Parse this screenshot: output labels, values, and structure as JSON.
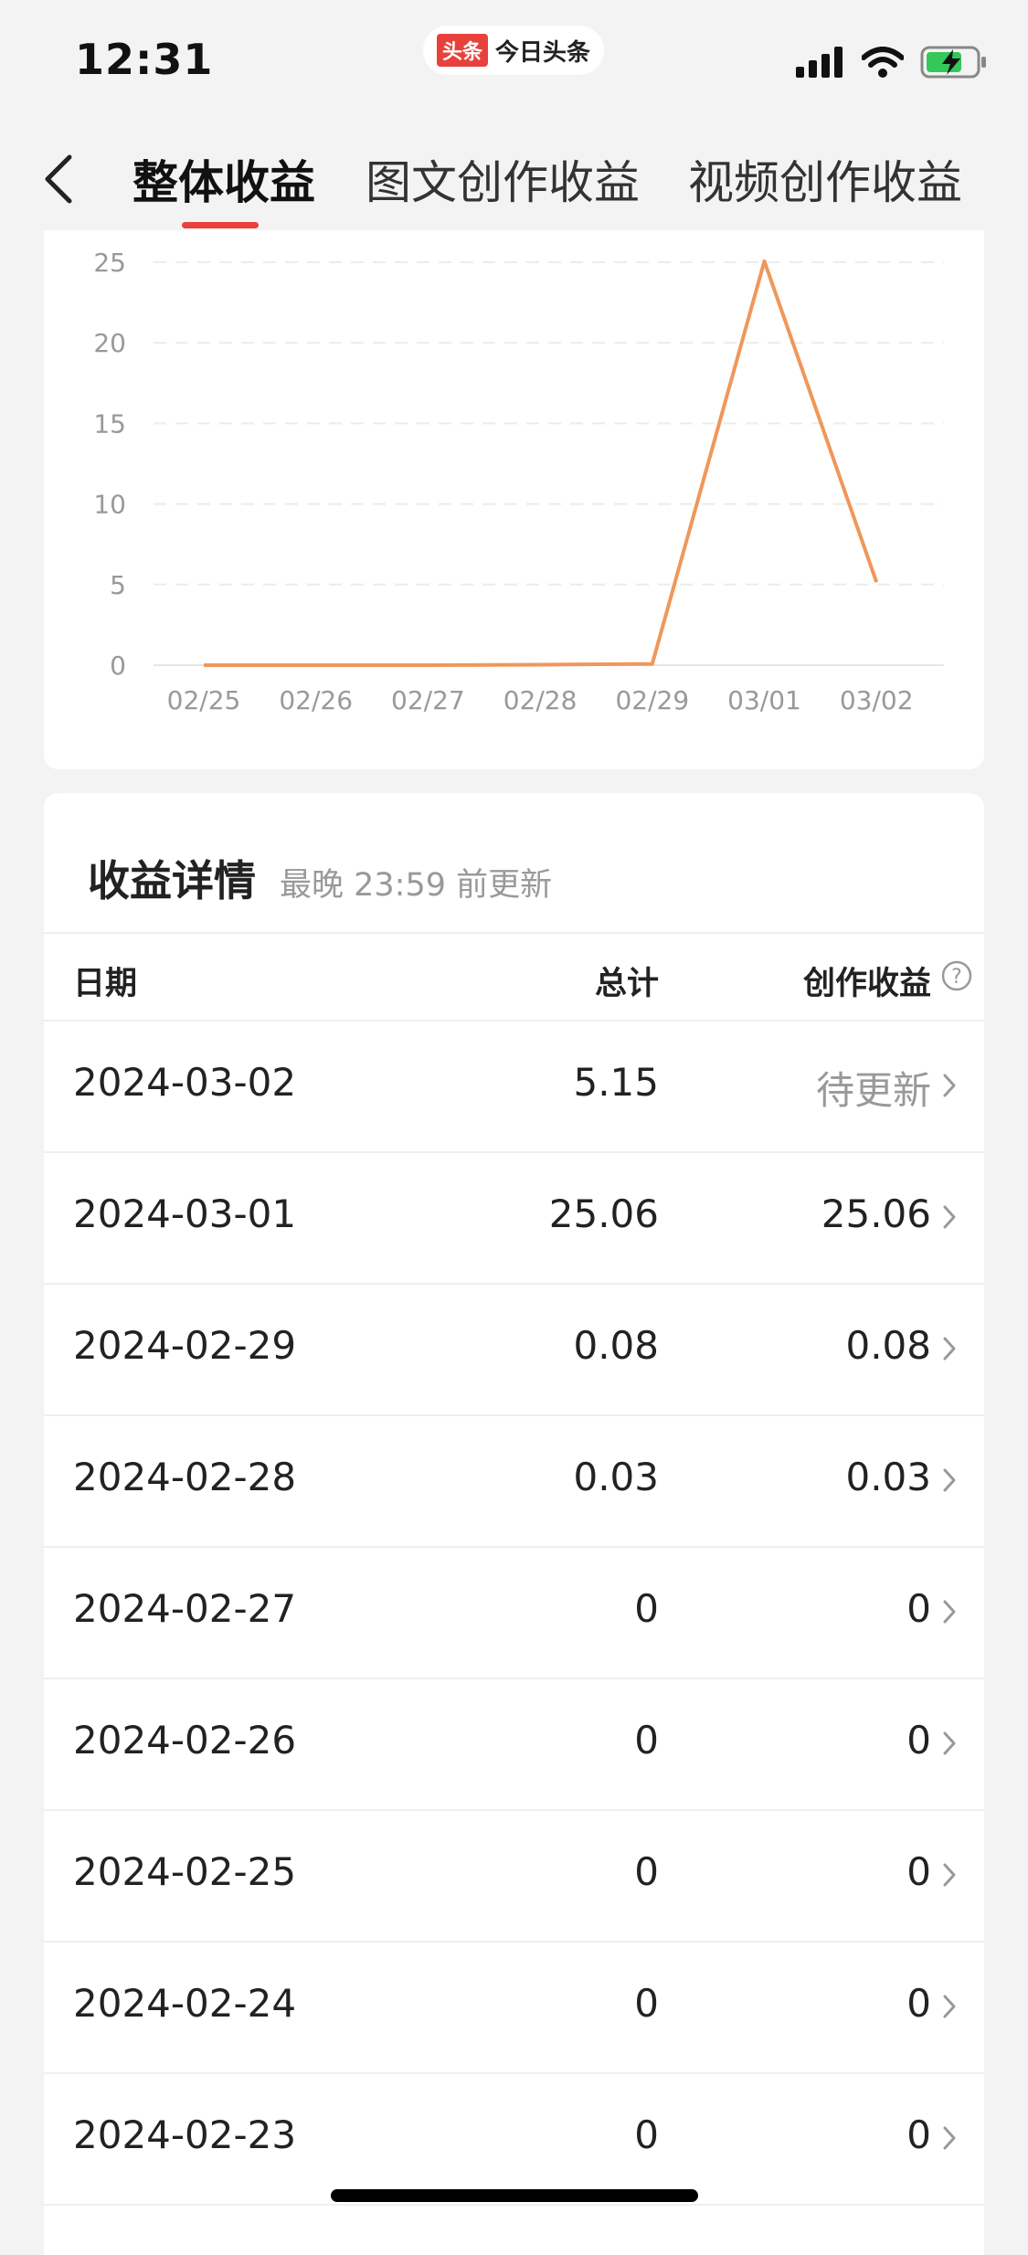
{
  "status_bar": {
    "time": "12:31",
    "app_logo": "头条",
    "app_name": "今日头条",
    "icons": [
      "signal-icon",
      "wifi-icon",
      "battery-charging-icon"
    ]
  },
  "header": {
    "back_icon": "back-chevron-icon",
    "tabs": [
      {
        "label": "整体收益",
        "active": true
      },
      {
        "label": "图文创作收益",
        "active": false
      },
      {
        "label": "视频创作收益",
        "active": false
      }
    ],
    "accent_color": "#e8413c"
  },
  "chart_data": {
    "type": "line",
    "categories": [
      "02/25",
      "02/26",
      "02/27",
      "02/28",
      "02/29",
      "03/01",
      "03/02"
    ],
    "series": [
      {
        "values": [
          0,
          0,
          0,
          0.03,
          0.08,
          25.06,
          5.15
        ],
        "color": "#f0975a"
      }
    ],
    "y_ticks": [
      0,
      5,
      10,
      15,
      20,
      25
    ],
    "ylim": [
      0,
      25
    ],
    "grid": true
  },
  "detail": {
    "title": "收益详情",
    "subtitle": "最晚 23:59 前更新",
    "columns": {
      "date": "日期",
      "total": "总计",
      "creation": "创作收益"
    },
    "help_icon": "question-circle-icon",
    "rows": [
      {
        "date": "2024-03-02",
        "total": "5.15",
        "creation": "待更新"
      },
      {
        "date": "2024-03-01",
        "total": "25.06",
        "creation": "25.06"
      },
      {
        "date": "2024-02-29",
        "total": "0.08",
        "creation": "0.08"
      },
      {
        "date": "2024-02-28",
        "total": "0.03",
        "creation": "0.03"
      },
      {
        "date": "2024-02-27",
        "total": "0",
        "creation": "0"
      },
      {
        "date": "2024-02-26",
        "total": "0",
        "creation": "0"
      },
      {
        "date": "2024-02-25",
        "total": "0",
        "creation": "0"
      },
      {
        "date": "2024-02-24",
        "total": "0",
        "creation": "0"
      },
      {
        "date": "2024-02-23",
        "total": "0",
        "creation": "0"
      }
    ]
  }
}
